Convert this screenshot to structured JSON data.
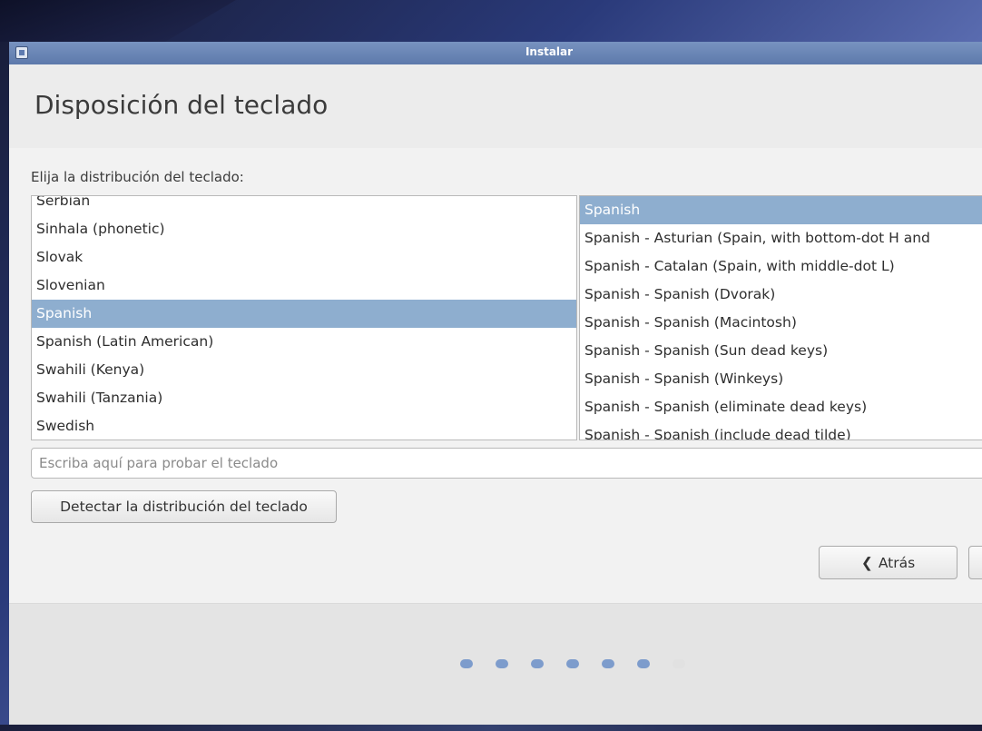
{
  "window": {
    "title": "Instalar"
  },
  "header": {
    "title": "Disposición del teclado"
  },
  "main": {
    "prompt": "Elija la distribución del teclado:",
    "layouts": [
      "Serbian",
      "Sinhala (phonetic)",
      "Slovak",
      "Slovenian",
      "Spanish",
      "Spanish (Latin American)",
      "Swahili (Kenya)",
      "Swahili (Tanzania)",
      "Swedish"
    ],
    "selected_layout": "Spanish",
    "variants": [
      "Spanish",
      "Spanish - Asturian (Spain, with bottom-dot H and",
      "Spanish - Catalan (Spain, with middle-dot L)",
      "Spanish - Spanish (Dvorak)",
      "Spanish - Spanish (Macintosh)",
      "Spanish - Spanish (Sun dead keys)",
      "Spanish - Spanish (Winkeys)",
      "Spanish - Spanish (eliminate dead keys)",
      "Spanish - Spanish (include dead tilde)"
    ],
    "selected_variant": "Spanish",
    "test_input": {
      "value": "",
      "placeholder": "Escriba aquí para probar el teclado"
    },
    "detect_label": "Detectar la distribución del teclado"
  },
  "navigation": {
    "back_label": "Atrás",
    "back_icon": "chevron-left-icon"
  },
  "progress": {
    "total_steps": 7,
    "completed_steps": 6
  },
  "colors": {
    "selection": "#8eaecf",
    "titlebar": "#6a86b8",
    "progress_dot": "#7d9ccc"
  }
}
